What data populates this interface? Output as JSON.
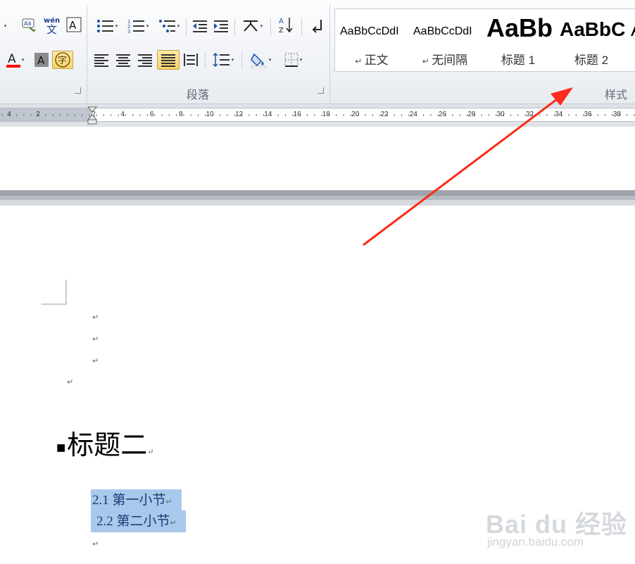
{
  "ribbon": {
    "paragraph_group_label": "段落",
    "styles_group_label": "样式",
    "font_buttons": [
      "phonetic-guide",
      "wen-ying",
      "character-border",
      "font-color",
      "character-shading",
      "enclosed-character"
    ],
    "colors": {
      "font_color_bar": "#ff0000",
      "active_button_bg": "#f9d56a",
      "arrow": "#ff2a1a"
    }
  },
  "styles_gallery": {
    "items": [
      {
        "sample": "AaBbCcDdI",
        "name": "正文"
      },
      {
        "sample": "AaBbCcDdI",
        "name": "无间隔"
      },
      {
        "sample": "AaBb",
        "name": "标题 1"
      },
      {
        "sample": "AaBbC",
        "name": "标题 2"
      }
    ]
  },
  "ruler": {
    "labels": [
      "4",
      "2",
      "2",
      "4",
      "6",
      "8",
      "10",
      "12",
      "14",
      "16",
      "18",
      "20",
      "22",
      "24",
      "26",
      "28",
      "30",
      "32",
      "34",
      "36",
      "38"
    ]
  },
  "document": {
    "paragraph_mark": "↵",
    "heading": "标题二",
    "toc": [
      {
        "text": "2.1 第一小节"
      },
      {
        "text": "2.2 第二小节"
      }
    ]
  },
  "watermark": {
    "logo": "Bai du 经验",
    "url": "jingyan.baidu.com"
  }
}
